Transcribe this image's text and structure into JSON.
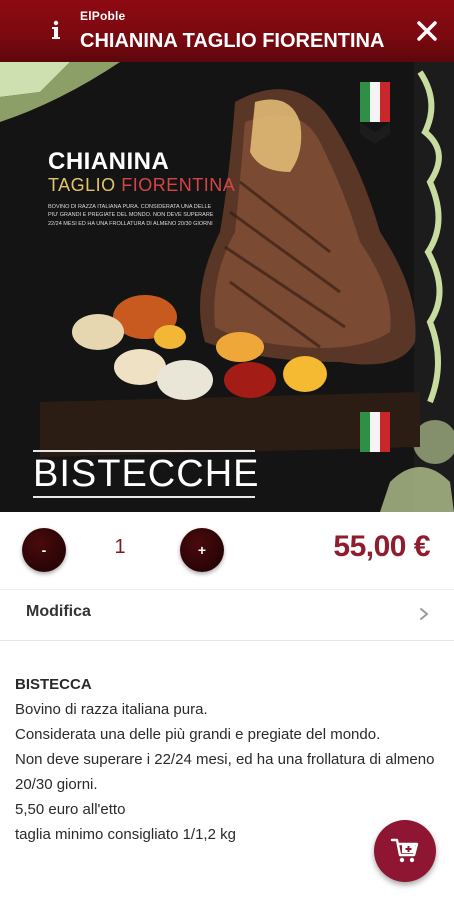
{
  "header": {
    "app_name": "ElPoble",
    "title": "CHIANINA TAGLIO FIORENTINA",
    "info_icon": "info-icon",
    "close_icon": "close-icon"
  },
  "hero": {
    "title_line1": "CHIANINA",
    "title_line2_word1": "TAGLIO",
    "title_line2_word2": "FIORENTINA",
    "small_text": "Bovino di razza italiana pura. Considerata una delle piu' grandi e pregiate del mondo. Non deve superare 22/24 mesi ed ha una frollatura di almeno 20/30 giorni",
    "banner": "BISTECCHE"
  },
  "quantity": {
    "minus_label": "-",
    "value": "1",
    "plus_label": "+"
  },
  "price": "55,00 €",
  "modifica": {
    "label": "Modifica",
    "icon": "chevron-right-icon"
  },
  "description": {
    "title": "BISTECCA",
    "lines": [
      "Bovino di razza italiana pura.",
      "Considerata una delle più grandi e pregiate del mondo.",
      "Non deve superare i 22/24 mesi, ed ha una frollatura di almeno 20/30 giorni.",
      "5,50 euro all'etto",
      "taglia minimo consigliato 1/1,2 kg"
    ]
  },
  "fab": {
    "icon": "add-to-cart-icon"
  },
  "colors": {
    "header_bg": "#7a0910",
    "accent": "#8e1633",
    "price": "#8f1d2e",
    "button_dark": "#2a0406"
  }
}
